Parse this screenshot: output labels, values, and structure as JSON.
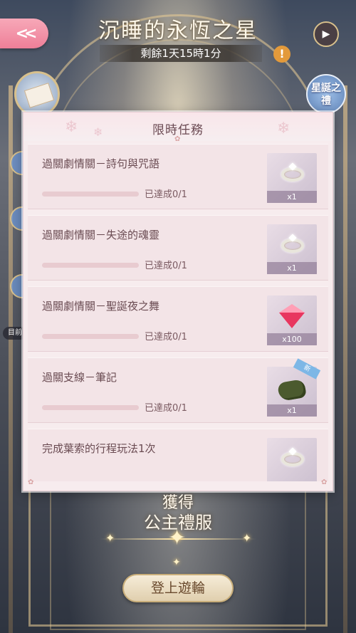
{
  "header": {
    "title": "沉睡的永恆之星",
    "timer": "剩餘1天15時1分",
    "warn_symbol": "!",
    "back_symbol": "<<",
    "next_symbol": "▶",
    "gift_label": "星誕之禮"
  },
  "side": {
    "current_label": "目前"
  },
  "panel": {
    "title": "限時任務",
    "tasks": [
      {
        "name": "過關劇情關－詩句與咒語",
        "progress": "已達成0/1",
        "progress_fraction": 0,
        "reward_icon": "ring-icon",
        "reward_count": "x1"
      },
      {
        "name": "過關劇情關－失途的魂靈",
        "progress": "已達成0/1",
        "progress_fraction": 0,
        "reward_icon": "ring-icon",
        "reward_count": "x1"
      },
      {
        "name": "過關劇情關－聖誕夜之舞",
        "progress": "已達成0/1",
        "progress_fraction": 0,
        "reward_icon": "diamond-icon",
        "reward_count": "x100"
      },
      {
        "name": "過關支線－筆記",
        "progress": "已達成0/1",
        "progress_fraction": 0,
        "reward_icon": "notebook-icon",
        "reward_count": "x1",
        "tag": "新"
      },
      {
        "name": "完成葉索的行程玩法1次",
        "reward_icon": "ring-icon"
      }
    ]
  },
  "bottom": {
    "gain_label": "獲得",
    "dress_label": "公主禮服",
    "board_button": "登上遊輪"
  },
  "colors": {
    "accent_pink": "#ee7f98",
    "panel_bg": "#f7ecee",
    "text_brown": "#6a4b52"
  }
}
